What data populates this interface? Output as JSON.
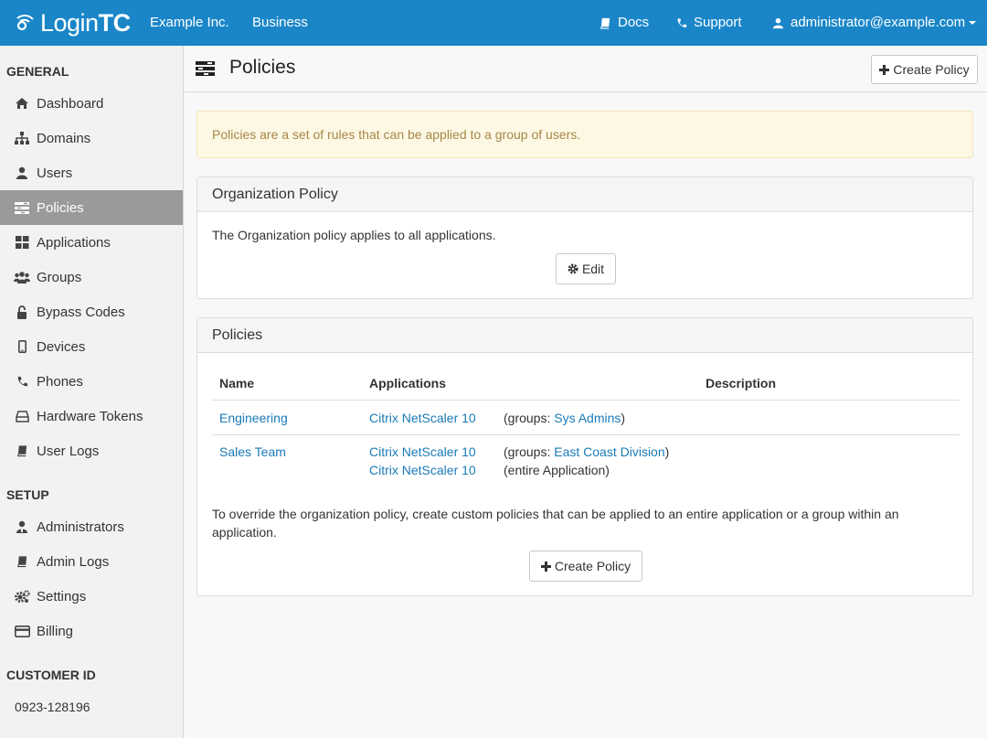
{
  "topbar": {
    "logo_light": "Login",
    "logo_bold": "TC",
    "org": "Example Inc.",
    "plan": "Business",
    "docs": "Docs",
    "support": "Support",
    "account": "administrator@example.com"
  },
  "sidebar": {
    "general_heading": "GENERAL",
    "items": [
      {
        "label": "Dashboard",
        "icon": "home-icon"
      },
      {
        "label": "Domains",
        "icon": "sitemap-icon"
      },
      {
        "label": "Users",
        "icon": "user-icon"
      },
      {
        "label": "Policies",
        "icon": "tasks-icon"
      },
      {
        "label": "Applications",
        "icon": "grid-icon"
      },
      {
        "label": "Groups",
        "icon": "group-icon"
      },
      {
        "label": "Bypass Codes",
        "icon": "unlock-icon"
      },
      {
        "label": "Devices",
        "icon": "mobile-icon"
      },
      {
        "label": "Phones",
        "icon": "phone-icon"
      },
      {
        "label": "Hardware Tokens",
        "icon": "token-icon"
      },
      {
        "label": "User Logs",
        "icon": "book-icon"
      }
    ],
    "setup_heading": "SETUP",
    "setup_items": [
      {
        "label": "Administrators",
        "icon": "admin-user-icon"
      },
      {
        "label": "Admin Logs",
        "icon": "book-icon"
      },
      {
        "label": "Settings",
        "icon": "cogs-icon"
      },
      {
        "label": "Billing",
        "icon": "credit-card-icon"
      }
    ],
    "customer_heading": "CUSTOMER ID",
    "customer_id": "0923-128196"
  },
  "page": {
    "title": "Policies",
    "create_button": "Create Policy",
    "alert": "Policies are a set of rules that can be applied to a group of users."
  },
  "org_policy": {
    "heading": "Organization Policy",
    "text": "The Organization policy applies to all applications.",
    "edit_button": "Edit"
  },
  "policies": {
    "heading": "Policies",
    "columns": [
      "Name",
      "Applications",
      "Description"
    ],
    "rows": [
      {
        "name": "Engineering",
        "apps": [
          {
            "app": "Citrix NetScaler 10",
            "prefix": "(groups: ",
            "group": "Sys Admins",
            "suffix": ")"
          }
        ]
      },
      {
        "name": "Sales Team",
        "apps": [
          {
            "app": "Citrix NetScaler 10",
            "prefix": "(groups: ",
            "group": "East Coast Division",
            "suffix": ")"
          },
          {
            "app": "Citrix NetScaler 10",
            "scope": "(entire Application)"
          }
        ]
      }
    ],
    "footer_text_1": "To override the organization policy, create custom policies that can be applied to an entire application or a group within an",
    "footer_text_2": "application.",
    "create_button": "Create Policy"
  },
  "colors": {
    "navbar": "#1a86c8",
    "link": "#1a7ab8",
    "active_sidebar": "#9a9a9a",
    "alert_bg": "#fcf8e3",
    "alert_text": "#a8864a"
  }
}
